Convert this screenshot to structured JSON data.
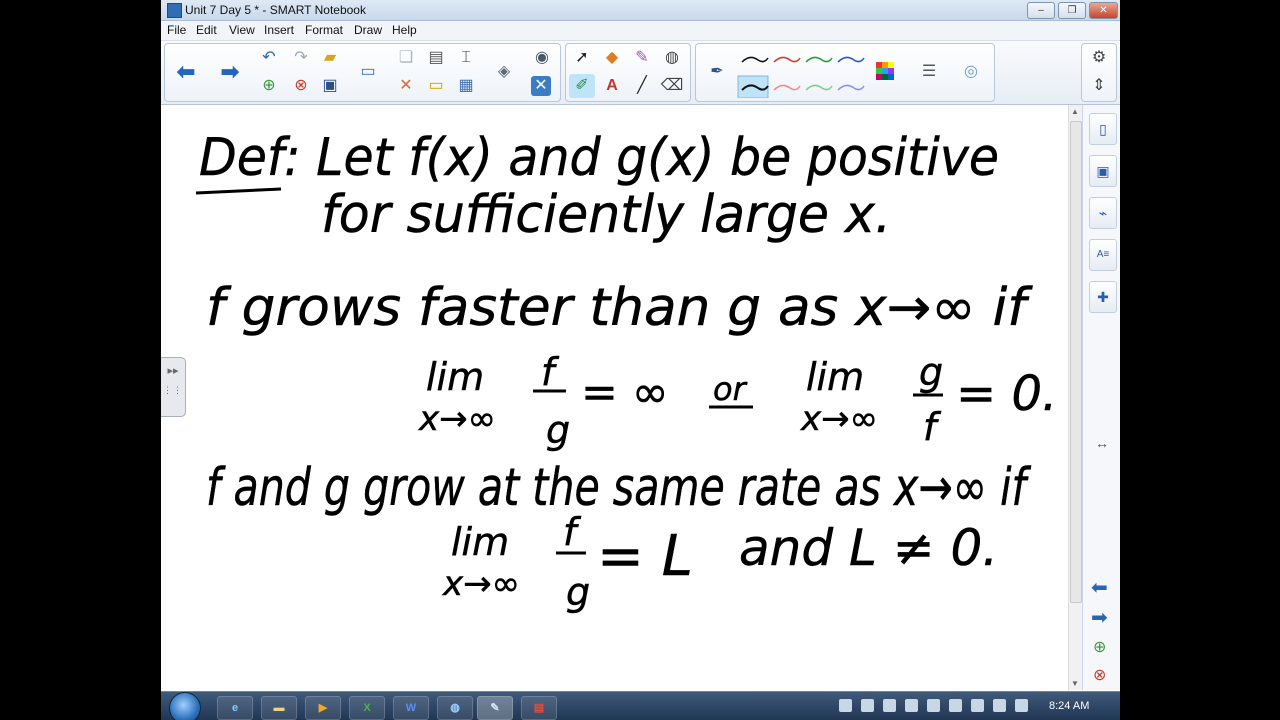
{
  "window": {
    "title": "Unit 7 Day 5 * - SMART Notebook"
  },
  "menu": [
    "File",
    "Edit",
    "View",
    "Insert",
    "Format",
    "Draw",
    "Help"
  ],
  "toolbar": {
    "icons": [
      "back-arrow-icon",
      "forward-arrow-icon",
      "undo-icon",
      "redo-icon",
      "open-icon",
      "new-page-icon",
      "delete-page-icon",
      "save-icon",
      "screen-icon",
      "clone-icon",
      "delete-icon",
      "screen-shade-icon",
      "table-icon",
      "capture-icon",
      "insert-image-icon",
      "document-camera-icon",
      "select-icon",
      "magic-pen-icon",
      "shapes-icon",
      "eraser-icon",
      "pens-icon",
      "text-icon",
      "line-icon",
      "fill-icon",
      "pen-tool-icon",
      "color-palette-icon",
      "properties-icon",
      "recognition-icon"
    ]
  },
  "notes": {
    "line1": "Def: Let f(x) and g(x) be positive",
    "line2": "for sufficiently large x.",
    "line3": "f grows faster than g as x→∞ if",
    "lim1_top": "lim",
    "lim1_bottom": "x→∞",
    "frac1_num": "f",
    "frac1_den": "g",
    "frac1_rhs": "= ∞",
    "or": "or",
    "lim2_top": "lim",
    "lim2_bottom": "x→∞",
    "frac2_num": "g",
    "frac2_den": "f",
    "frac2_rhs": "= 0.",
    "line4": "f and g grow at the same rate as x→∞ if",
    "lim3_top": "lim",
    "lim3_bottom": "x→∞",
    "frac3_num": "f",
    "frac3_den": "g",
    "frac3_rhs": "= L",
    "line5": "and L ≠ 0."
  },
  "taskbar": {
    "apps": [
      "IE",
      "Explorer",
      "Media",
      "X",
      "W",
      "Browser",
      "SMART",
      "PDF"
    ],
    "clock": "8:24 AM"
  }
}
